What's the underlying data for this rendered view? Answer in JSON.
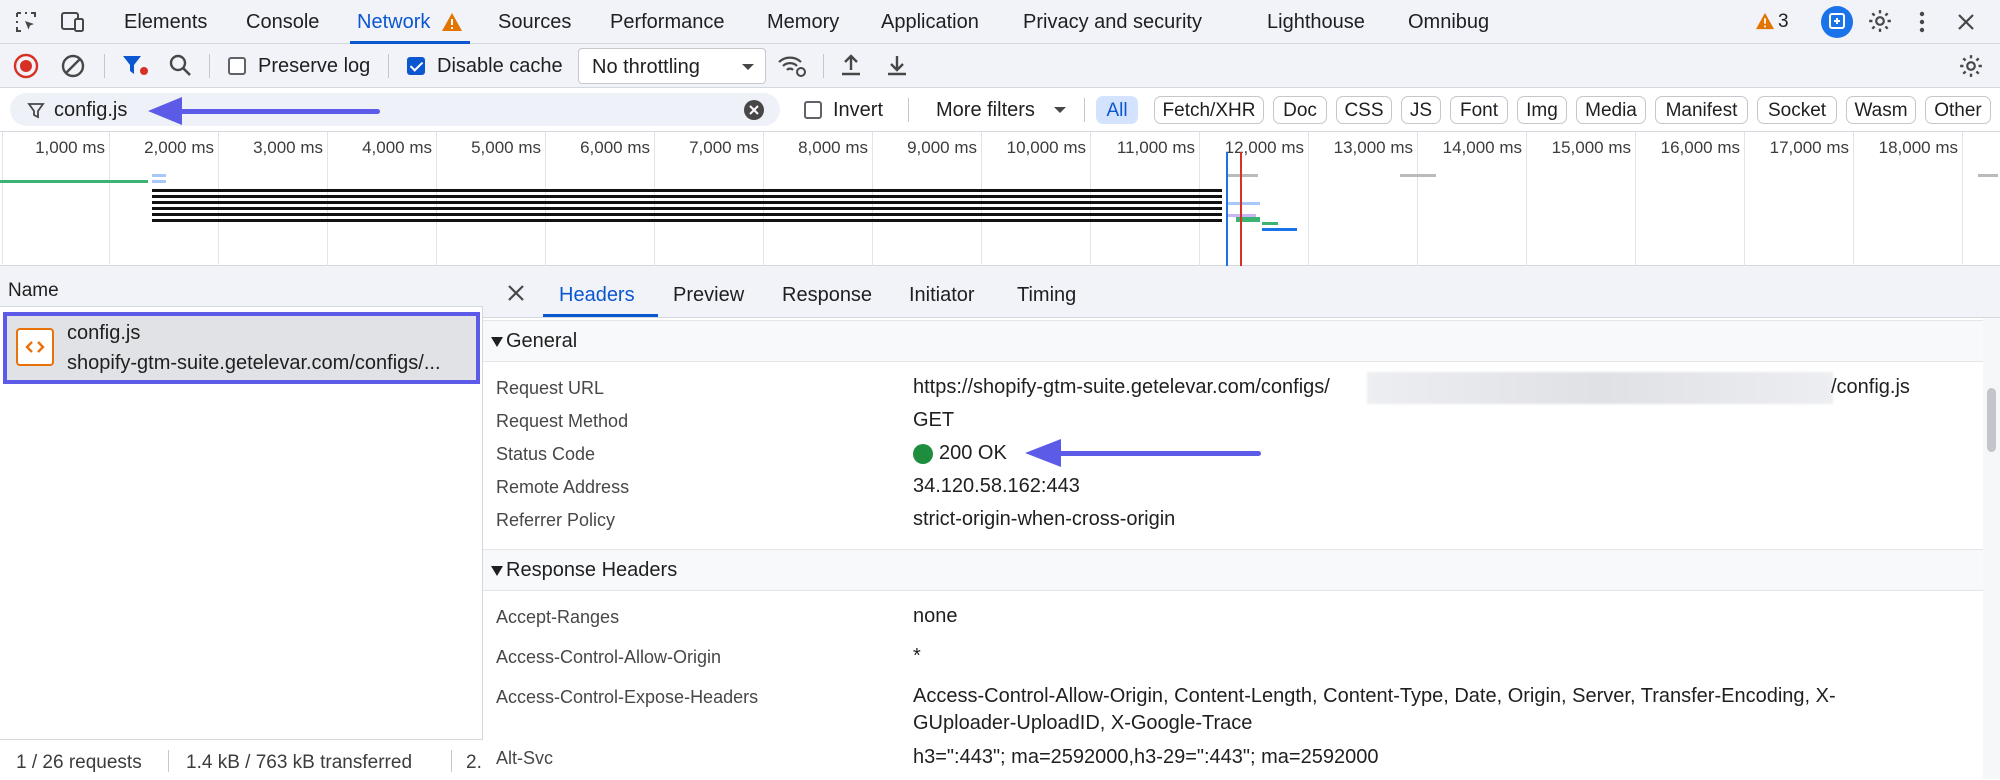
{
  "tabbar": {
    "tabs": [
      "Elements",
      "Console",
      "Network",
      "Sources",
      "Performance",
      "Memory",
      "Application",
      "Privacy and security",
      "Lighthouse",
      "Omnibug"
    ],
    "warning_count": "3"
  },
  "toolbar": {
    "preserve_log": "Preserve log",
    "disable_cache": "Disable cache",
    "throttling": "No throttling"
  },
  "filter": {
    "value": "config.js",
    "invert": "Invert",
    "more_filters": "More filters",
    "types": [
      "All",
      "Fetch/XHR",
      "Doc",
      "CSS",
      "JS",
      "Font",
      "Img",
      "Media",
      "Manifest",
      "Socket",
      "Wasm",
      "Other"
    ]
  },
  "timeline": {
    "ticks": [
      "1,000 ms",
      "2,000 ms",
      "3,000 ms",
      "4,000 ms",
      "5,000 ms",
      "6,000 ms",
      "7,000 ms",
      "8,000 ms",
      "9,000 ms",
      "10,000 ms",
      "11,000 ms",
      "12,000 ms",
      "13,000 ms",
      "14,000 ms",
      "15,000 ms",
      "16,000 ms",
      "17,000 ms",
      "18,000 ms",
      "1"
    ]
  },
  "requests": {
    "column": "Name",
    "item_name": "config.js",
    "item_url": "shopify-gtm-suite.getelevar.com/configs/...",
    "status": "1 / 26 requests",
    "transferred": "1.4 kB / 763 kB transferred",
    "extra": "2."
  },
  "details": {
    "tabs": [
      "Headers",
      "Preview",
      "Response",
      "Initiator",
      "Timing"
    ],
    "general": {
      "title": "General",
      "request_url_label": "Request URL",
      "request_url_prefix": "https://shopify-gtm-suite.getelevar.com/configs/",
      "request_url_suffix": "/config.js",
      "method_label": "Request Method",
      "method": "GET",
      "status_label": "Status Code",
      "status": "200 OK",
      "status_color": "#1e8e3e",
      "remote_label": "Remote Address",
      "remote": "34.120.58.162:443",
      "referrer_label": "Referrer Policy",
      "referrer": "strict-origin-when-cross-origin"
    },
    "response": {
      "title": "Response Headers",
      "accept_ranges_label": "Accept-Ranges",
      "accept_ranges": "none",
      "acao_label": "Access-Control-Allow-Origin",
      "acao": "*",
      "aceh_label": "Access-Control-Expose-Headers",
      "aceh_1": "Access-Control-Allow-Origin, Content-Length, Content-Type, Date, Origin, Server, Transfer-Encoding, X-",
      "aceh_2": "GUploader-UploadID, X-Google-Trace",
      "altsvc_label": "Alt-Svc",
      "altsvc": "h3=\":443\"; ma=2592000,h3-29=\":443\"; ma=2592000"
    }
  },
  "colors": {
    "accent": "#0b57d0",
    "annotation": "#5b5be8",
    "warning": "#e37400",
    "record": "#d93025"
  }
}
